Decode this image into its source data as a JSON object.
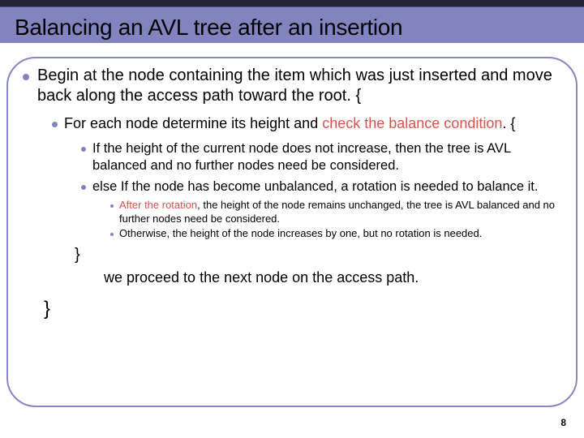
{
  "slide": {
    "title": "Balancing an AVL tree after an insertion",
    "lvl1": "Begin at the node containing the item which was just inserted and move back along the access path toward the root. {",
    "lvl2_a": " For each node determine its height and ",
    "lvl2_b": "check the balance condition",
    "lvl2_c": ". {",
    "lvl3_1": "If the height of the current node does not increase, then the tree is AVL balanced and no further nodes need be considered.",
    "lvl3_2": "else If the node has become unbalanced, a rotation is needed to balance it.",
    "lvl4_1a": "After the rotation",
    "lvl4_1b": ", the height of the node remains unchanged, the tree is AVL balanced and no further nodes need be considered.",
    "lvl4_2": "Otherwise, the height of the node increases by one, but no rotation is needed.",
    "close1": "}",
    "proceed": "we proceed to the next node on the access path.",
    "close0": "}",
    "page": "8"
  }
}
